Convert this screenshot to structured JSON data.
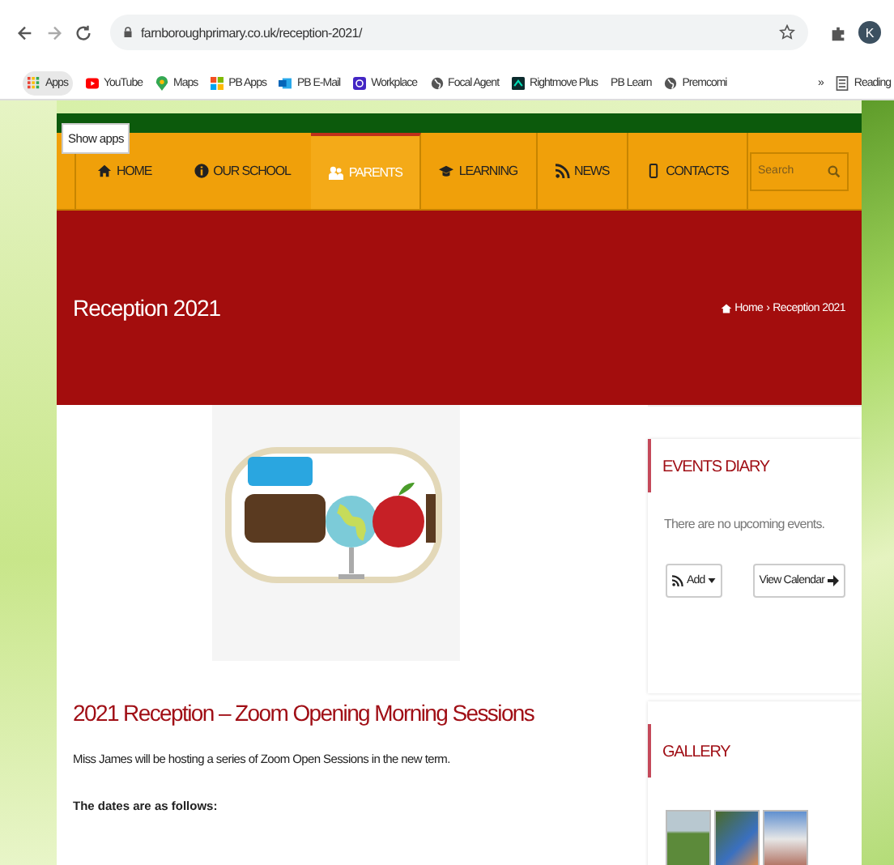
{
  "browser": {
    "url": "farnboroughprimary.co.uk/reception-2021/",
    "profile_initial": "K",
    "bookmarks": [
      {
        "label": "Apps",
        "kind": "apps"
      },
      {
        "label": "YouTube",
        "kind": "youtube"
      },
      {
        "label": "Maps",
        "kind": "maps"
      },
      {
        "label": "PB Apps",
        "kind": "tiles"
      },
      {
        "label": "PB E-Mail",
        "kind": "mail"
      },
      {
        "label": "Workplace",
        "kind": "workplace"
      },
      {
        "label": "Focal Agent",
        "kind": "globe"
      },
      {
        "label": "Rightmove Plus",
        "kind": "rightmove"
      },
      {
        "label": "PB Learn",
        "kind": "none"
      },
      {
        "label": "Premcomi",
        "kind": "globe"
      }
    ],
    "overflow": "»",
    "reading_list": "Reading"
  },
  "tooltip": "Show apps",
  "nav": {
    "items": [
      {
        "label": "HOME",
        "kind": "home",
        "selected": false
      },
      {
        "label": "OUR SCHOOL",
        "kind": "info",
        "selected": false
      },
      {
        "label": "PARENTS",
        "kind": "people",
        "selected": true
      },
      {
        "label": "LEARNING",
        "kind": "cap",
        "selected": false
      },
      {
        "label": "NEWS",
        "kind": "rss",
        "selected": false
      },
      {
        "label": "CONTACTS",
        "kind": "phone",
        "selected": false
      }
    ],
    "search_placeholder": "Search"
  },
  "banner": {
    "title": "Reception 2021",
    "breadcrumb": {
      "home": "Home",
      "separator": "›",
      "current": "Reception 2021"
    }
  },
  "article": {
    "heading": "2021 Reception – Zoom Opening Morning Sessions",
    "paragraph": "Miss James will be hosting a series of Zoom Open Sessions in the new term.",
    "dates_heading": "The dates are as follows:"
  },
  "sidebar": {
    "events": {
      "title": "EVENTS DIARY",
      "empty": "There are no upcoming events.",
      "add_button": "Add",
      "calendar_button": "View Calendar"
    },
    "gallery": {
      "title": "GALLERY"
    }
  }
}
